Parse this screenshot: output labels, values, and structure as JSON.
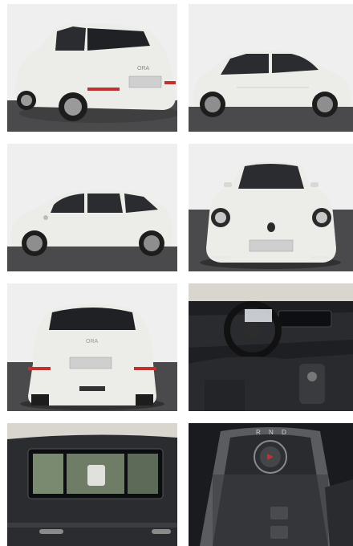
{
  "gallery": {
    "photos": [
      {
        "view": "rear-three-quarter"
      },
      {
        "view": "side-right"
      },
      {
        "view": "side-left"
      },
      {
        "view": "front"
      },
      {
        "view": "rear"
      },
      {
        "view": "interior-dashboard"
      },
      {
        "view": "infotainment-screen"
      },
      {
        "view": "gear-selector"
      }
    ],
    "badge_text": "ORA",
    "shifter_text": "R N D",
    "colors": {
      "car_body": "#ecece8",
      "floor": "#4a4a4c",
      "backdrop": "#ececec",
      "interior_dark": "#1e1f22"
    }
  }
}
